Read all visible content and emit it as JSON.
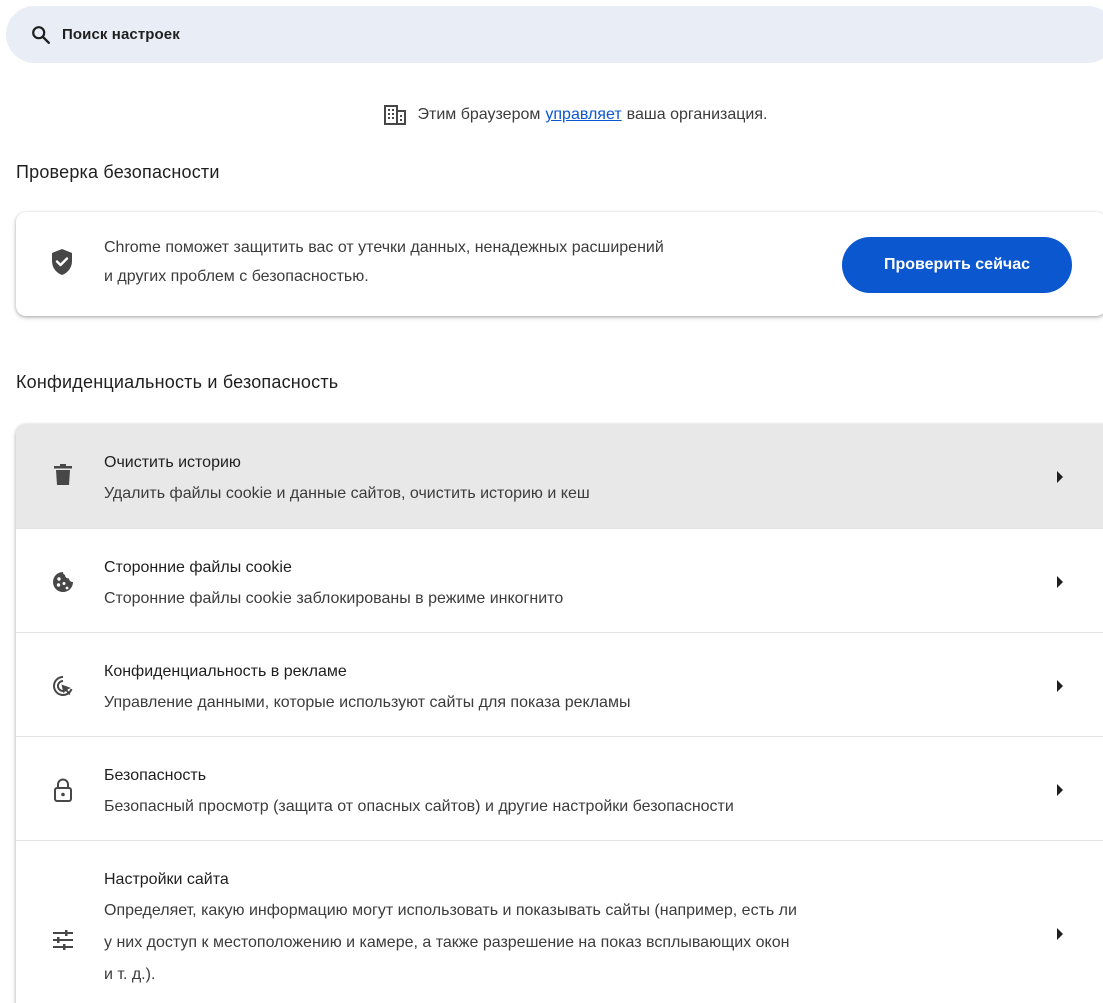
{
  "search": {
    "placeholder": "Поиск настроек",
    "icon": "search-icon"
  },
  "managed_notice": {
    "icon": "building-icon",
    "prefix": "Этим браузером",
    "link": "управляет",
    "suffix": "ваша организация."
  },
  "safety_check": {
    "title": "Проверка безопасности",
    "icon": "shield-check-icon",
    "description_line1": "Chrome поможет защитить вас от утечки данных, ненадежных расширений",
    "description_line2": "и других проблем с безопасностью.",
    "button_label": "Проверить сейчас"
  },
  "privacy": {
    "title": "Конфиденциальность и безопасность",
    "items": [
      {
        "icon": "trash-icon",
        "title": "Очистить историю",
        "subtitle_lines": [
          "Удалить файлы cookie и данные сайтов, очистить историю и кеш"
        ]
      },
      {
        "icon": "cookie-icon",
        "title": "Сторонние файлы cookie",
        "subtitle_lines": [
          "Сторонние файлы cookie заблокированы в режиме инкогнито"
        ]
      },
      {
        "icon": "ad-privacy-icon",
        "title": "Конфиденциальность в рекламе",
        "subtitle_lines": [
          "Управление данными, которые используют сайты для показа рекламы"
        ]
      },
      {
        "icon": "lock-icon",
        "title": "Безопасность",
        "subtitle_lines": [
          "Безопасный просмотр (защита от опасных сайтов) и другие настройки безопасности"
        ]
      },
      {
        "icon": "tune-icon",
        "title": "Настройки сайта",
        "subtitle_lines": [
          "Определяет, какую информацию могут использовать и показывать сайты (например, есть ли",
          "у них доступ к местоположению и камере, а также разрешение на показ всплывающих окон",
          "и т. д.)."
        ]
      }
    ]
  },
  "colors": {
    "accent": "#0b57d0",
    "search_bg": "#e9eef6",
    "hover_row": "#e8e8e8",
    "icon": "#474747"
  }
}
